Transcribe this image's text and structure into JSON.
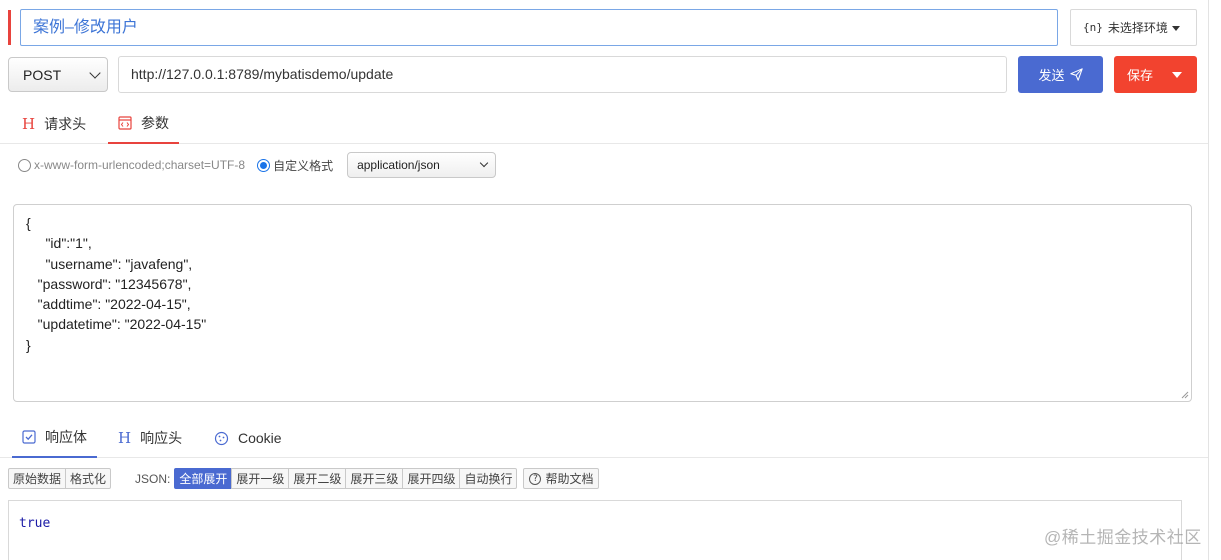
{
  "request": {
    "name": "案例–修改用户",
    "environment_label": "未选择环境",
    "environment_icon": "{n}",
    "method": "POST",
    "url": "http://127.0.0.1:8789/mybatisdemo/update",
    "send_label": "发送",
    "save_label": "保存"
  },
  "request_tabs": {
    "headers_label": "请求头",
    "params_label": "参数",
    "active": "params"
  },
  "body_type": {
    "urlencoded_label": "x-www-form-urlencoded;charset=UTF-8",
    "custom_label": "自定义格式",
    "selected": "custom",
    "content_type": "application/json"
  },
  "body_text": "{\n     \"id\":\"1\",\n     \"username\": \"javafeng\",\n   \"password\": \"12345678\",\n   \"addtime\": \"2022-04-15\",\n   \"updatetime\": \"2022-04-15\"\n}",
  "response_tabs": {
    "body_label": "响应体",
    "headers_label": "响应头",
    "cookie_label": "Cookie",
    "active": "body"
  },
  "response_toolbar": {
    "raw_label": "原始数据",
    "format_label": "格式化",
    "json_label": "JSON:",
    "expand_all": "全部展开",
    "expand_1": "展开一级",
    "expand_2": "展开二级",
    "expand_3": "展开三级",
    "expand_4": "展开四级",
    "wrap": "自动换行",
    "help": "帮助文档",
    "active": "expand_all"
  },
  "response_body": "true",
  "watermark": "@稀土掘金技术社区",
  "colors": {
    "accent_red": "#e8433d",
    "primary_blue": "#4a6ad1",
    "save_red": "#f2432f"
  }
}
